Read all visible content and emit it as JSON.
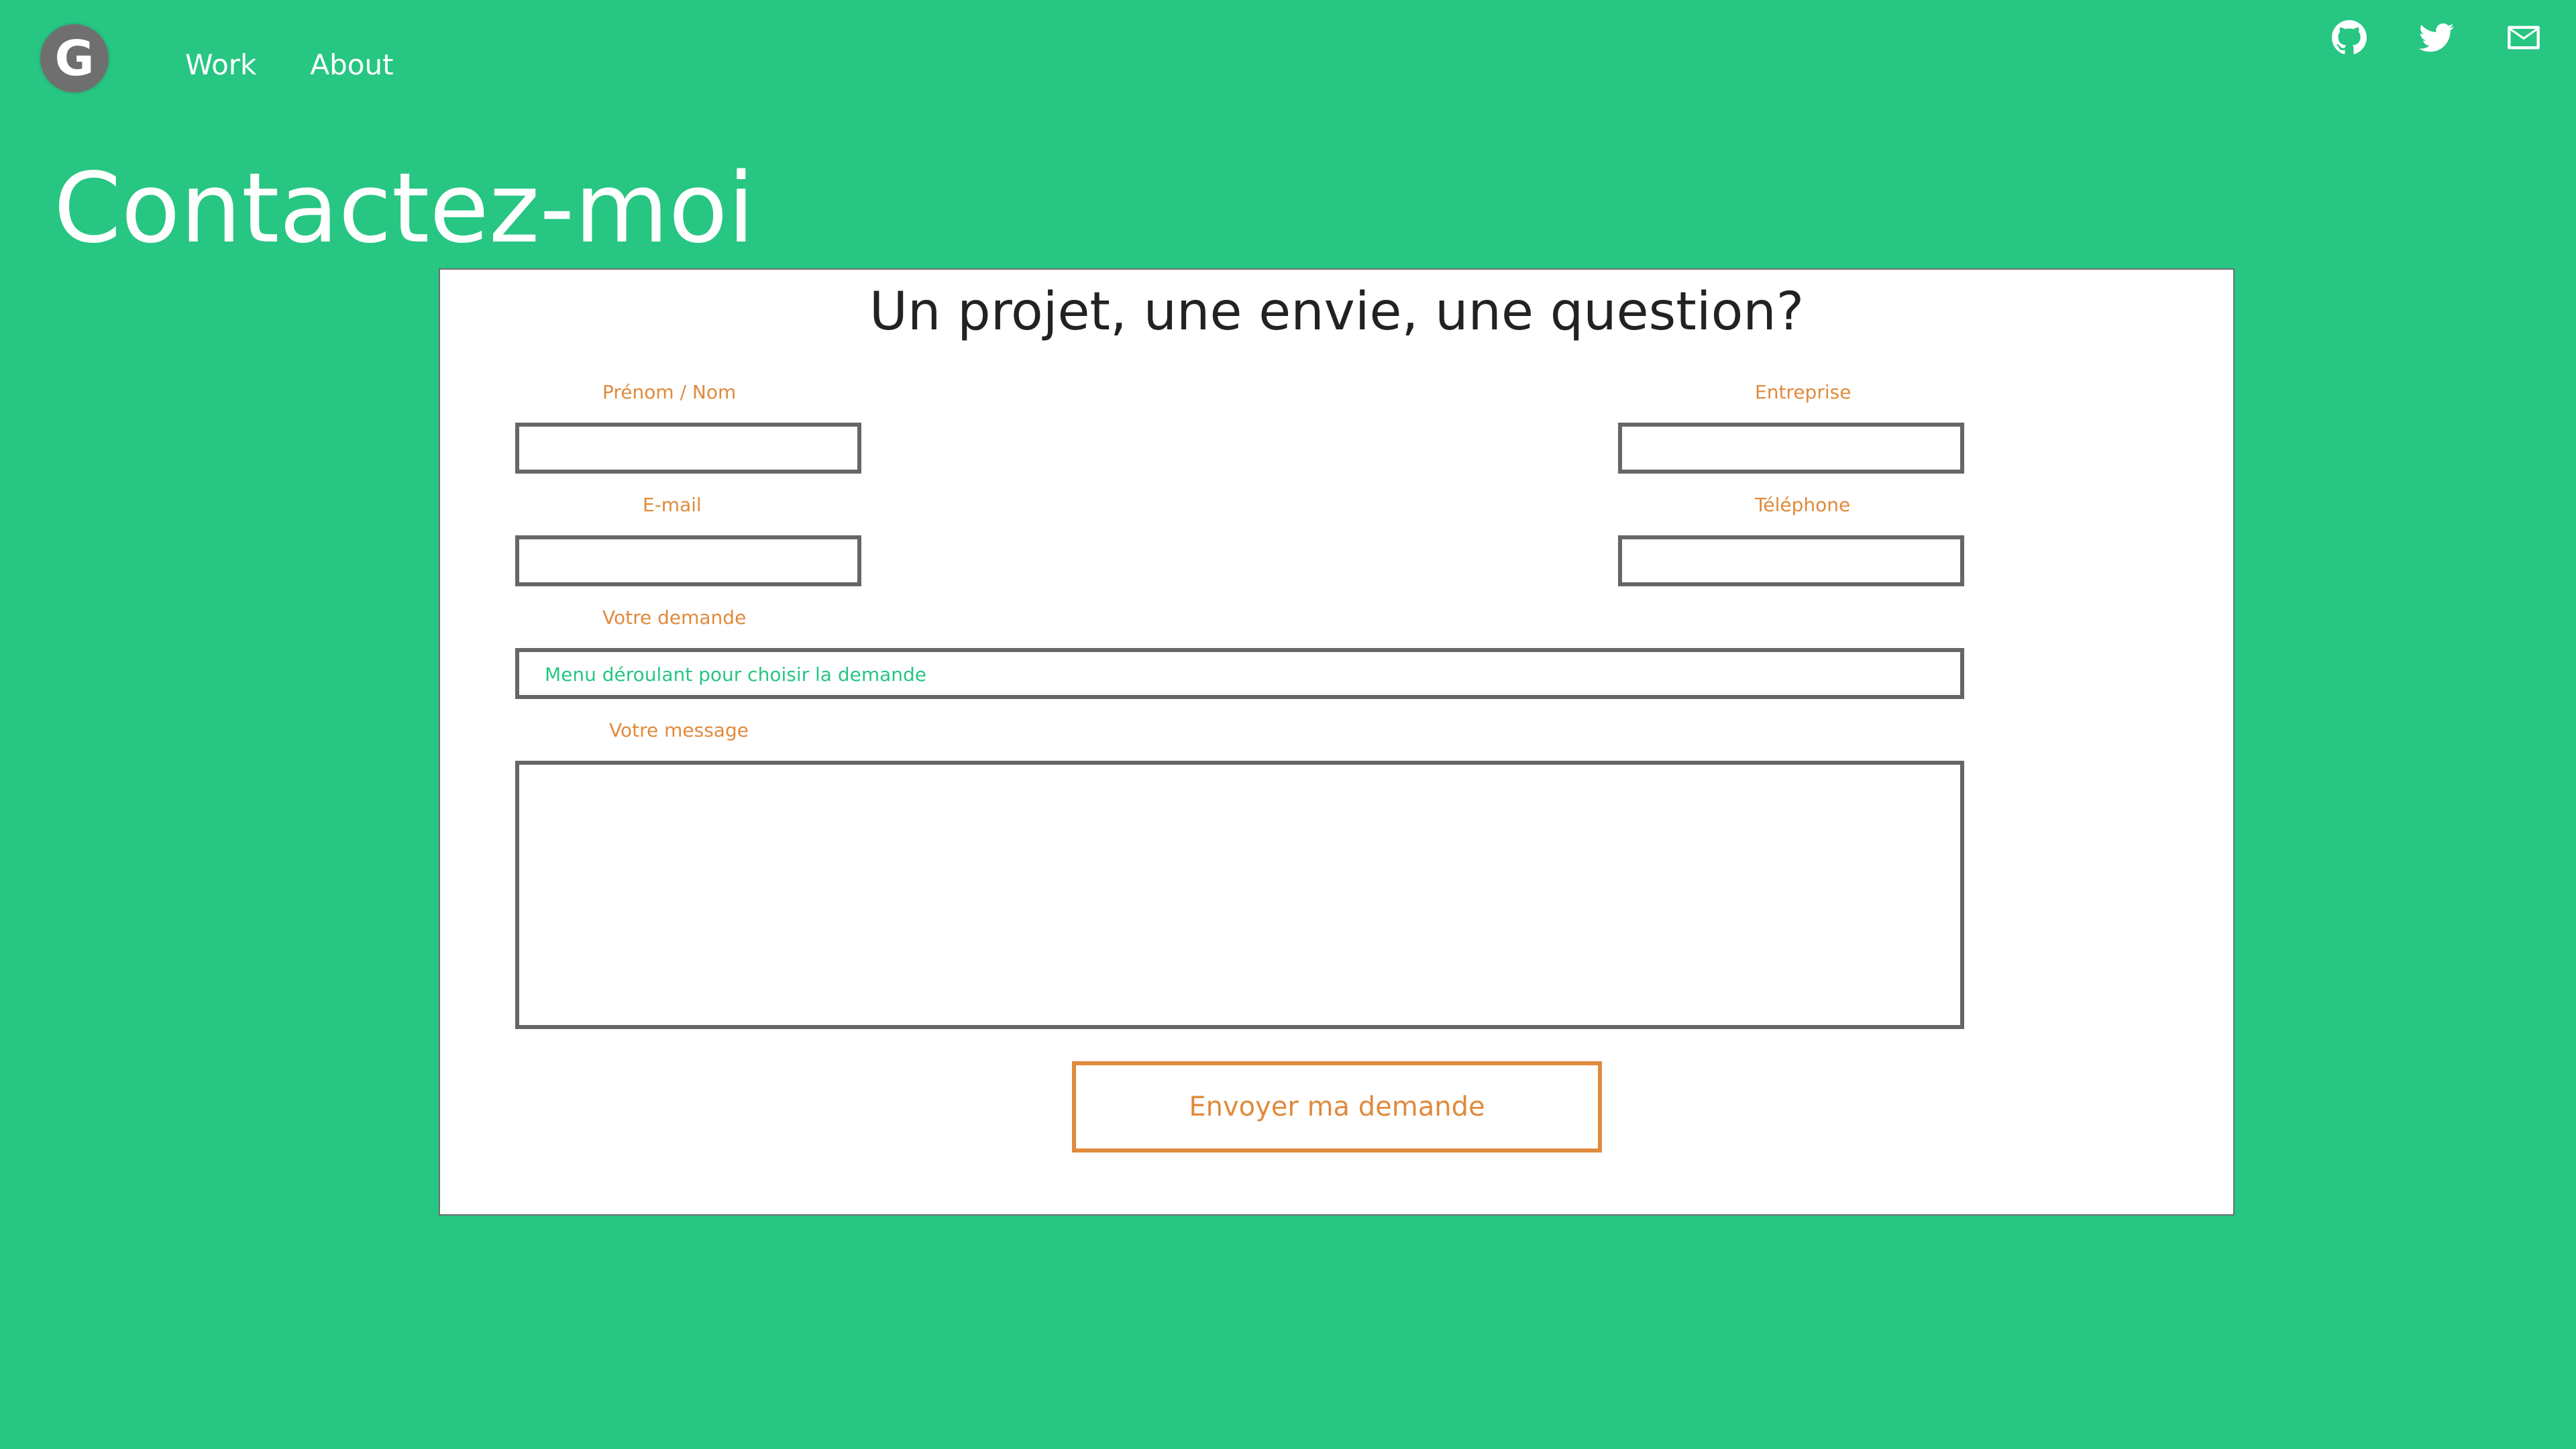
{
  "nav": {
    "logo_letter": "G",
    "items": [
      {
        "label": "Work"
      },
      {
        "label": "About"
      }
    ]
  },
  "social": {
    "icons": [
      "github-icon",
      "twitter-icon",
      "mail-icon"
    ]
  },
  "page": {
    "title": "Contactez-moi"
  },
  "form": {
    "heading": "Un projet, une envie, une question?",
    "fields": {
      "name_label": "Prénom / Nom",
      "company_label": "Entreprise",
      "email_label": "E-mail",
      "phone_label": "Téléphone",
      "request_label": "Votre demande",
      "request_placeholder": "Menu déroulant pour choisir la demande",
      "message_label": "Votre message"
    },
    "submit_label": "Envoyer ma demande"
  },
  "colors": {
    "background": "#27c682",
    "accent": "#e08a3c",
    "border": "#666666",
    "logo": "#6f6f6f"
  }
}
